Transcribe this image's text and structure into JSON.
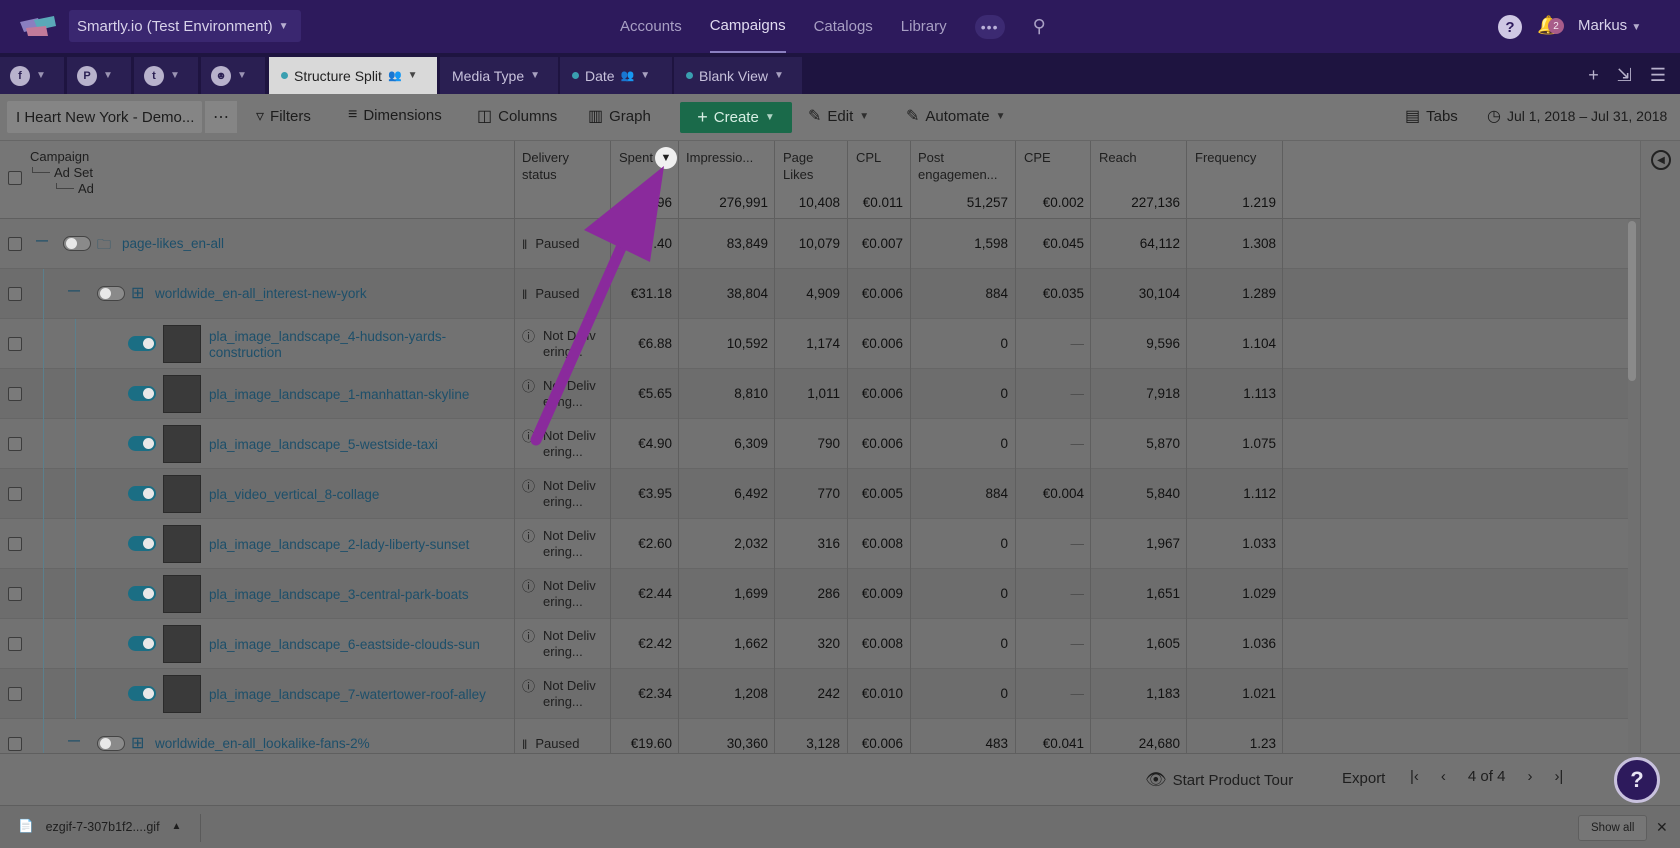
{
  "topnav": {
    "env_label": "Smartly.io (Test Environment)",
    "links": [
      "Accounts",
      "Campaigns",
      "Catalogs",
      "Library"
    ],
    "active": "Campaigns",
    "more": "•••",
    "notif_count": "2",
    "user": "Markus"
  },
  "tabs": {
    "networks": [
      "facebook-icon",
      "pinterest-icon",
      "twitter-icon",
      "snapchat-icon"
    ],
    "views": [
      {
        "label": "Structure Split",
        "active": true
      },
      {
        "label": "Media Type",
        "active": false
      },
      {
        "label": "Date",
        "active": false
      },
      {
        "label": "Blank View",
        "active": false
      }
    ]
  },
  "toolbar": {
    "account": "I Heart New York - Demo...",
    "filters": "Filters",
    "dimensions": "Dimensions",
    "columns": "Columns",
    "graph": "Graph",
    "create": "Create",
    "edit": "Edit",
    "automate": "Automate",
    "tabs": "Tabs",
    "date_range": "Jul 1, 2018 – Jul 31, 2018"
  },
  "table": {
    "hierarchy": {
      "campaign": "Campaign",
      "adset": "Ad Set",
      "ad": "Ad"
    },
    "headers": {
      "delivery": [
        "Delivery",
        "status"
      ],
      "spent": "Spent",
      "impressions": "Impressio...",
      "page_likes": [
        "Page",
        "Likes"
      ],
      "cpl": "CPL",
      "post_eng": [
        "Post",
        "engagemen..."
      ],
      "cpe": "CPE",
      "reach": "Reach",
      "frequency": "Frequency"
    },
    "totals": {
      "spent": "€...96",
      "impressions": "276,991",
      "page_likes": "10,408",
      "cpl": "€0.011",
      "post_eng": "51,257",
      "cpe": "€0.002",
      "reach": "227,136",
      "frequency": "1.219"
    },
    "rows": [
      {
        "level": "campaign",
        "name": "page-likes_en-all",
        "status": "Paused",
        "spent": "€...40",
        "impressions": "83,849",
        "page_likes": "10,079",
        "cpl": "€0.007",
        "post_eng": "1,598",
        "cpe": "€0.045",
        "reach": "64,112",
        "frequency": "1.308"
      },
      {
        "level": "adset",
        "name": "worldwide_en-all_interest-new-york",
        "status": "Paused",
        "spent": "€31.18",
        "impressions": "38,804",
        "page_likes": "4,909",
        "cpl": "€0.006",
        "post_eng": "884",
        "cpe": "€0.035",
        "reach": "30,104",
        "frequency": "1.289"
      },
      {
        "level": "ad",
        "name": "pla_image_landscape_4-hudson-yards-construction",
        "status": "Not Delivering...",
        "spent": "€6.88",
        "impressions": "10,592",
        "page_likes": "1,174",
        "cpl": "€0.006",
        "post_eng": "0",
        "cpe": "—",
        "reach": "9,596",
        "frequency": "1.104"
      },
      {
        "level": "ad",
        "name": "pla_image_landscape_1-manhattan-skyline",
        "status": "Not Delivering...",
        "spent": "€5.65",
        "impressions": "8,810",
        "page_likes": "1,011",
        "cpl": "€0.006",
        "post_eng": "0",
        "cpe": "—",
        "reach": "7,918",
        "frequency": "1.113"
      },
      {
        "level": "ad",
        "name": "pla_image_landscape_5-westside-taxi",
        "status": "Not Delivering...",
        "spent": "€4.90",
        "impressions": "6,309",
        "page_likes": "790",
        "cpl": "€0.006",
        "post_eng": "0",
        "cpe": "—",
        "reach": "5,870",
        "frequency": "1.075"
      },
      {
        "level": "ad",
        "name": "pla_video_vertical_8-collage",
        "status": "Not Delivering...",
        "spent": "€3.95",
        "impressions": "6,492",
        "page_likes": "770",
        "cpl": "€0.005",
        "post_eng": "884",
        "cpe": "€0.004",
        "reach": "5,840",
        "frequency": "1.112"
      },
      {
        "level": "ad",
        "name": "pla_image_landscape_2-lady-liberty-sunset",
        "status": "Not Delivering...",
        "spent": "€2.60",
        "impressions": "2,032",
        "page_likes": "316",
        "cpl": "€0.008",
        "post_eng": "0",
        "cpe": "—",
        "reach": "1,967",
        "frequency": "1.033"
      },
      {
        "level": "ad",
        "name": "pla_image_landscape_3-central-park-boats",
        "status": "Not Delivering...",
        "spent": "€2.44",
        "impressions": "1,699",
        "page_likes": "286",
        "cpl": "€0.009",
        "post_eng": "0",
        "cpe": "—",
        "reach": "1,651",
        "frequency": "1.029"
      },
      {
        "level": "ad",
        "name": "pla_image_landscape_6-eastside-clouds-sun",
        "status": "Not Delivering...",
        "spent": "€2.42",
        "impressions": "1,662",
        "page_likes": "320",
        "cpl": "€0.008",
        "post_eng": "0",
        "cpe": "—",
        "reach": "1,605",
        "frequency": "1.036"
      },
      {
        "level": "ad",
        "name": "pla_image_landscape_7-watertower-roof-alley",
        "status": "Not Delivering...",
        "spent": "€2.34",
        "impressions": "1,208",
        "page_likes": "242",
        "cpl": "€0.010",
        "post_eng": "0",
        "cpe": "—",
        "reach": "1,183",
        "frequency": "1.021"
      },
      {
        "level": "adset",
        "name": "worldwide_en-all_lookalike-fans-2%",
        "status": "Paused",
        "spent": "€19.60",
        "impressions": "30,360",
        "page_likes": "3,128",
        "cpl": "€0.006",
        "post_eng": "483",
        "cpe": "€0.041",
        "reach": "24,680",
        "frequency": "1.23"
      }
    ]
  },
  "footer": {
    "tour": "Start Product Tour",
    "export": "Export",
    "page": "4 of 4"
  },
  "downloads": {
    "file": "ezgif-7-307b1f2....gif",
    "show_all": "Show all"
  },
  "colors": {
    "nav_bg": "#2d1a5c",
    "create_green": "#1a6a4a",
    "link_blue": "#1d4f6a",
    "arrow_purple": "#8a2a9c"
  }
}
